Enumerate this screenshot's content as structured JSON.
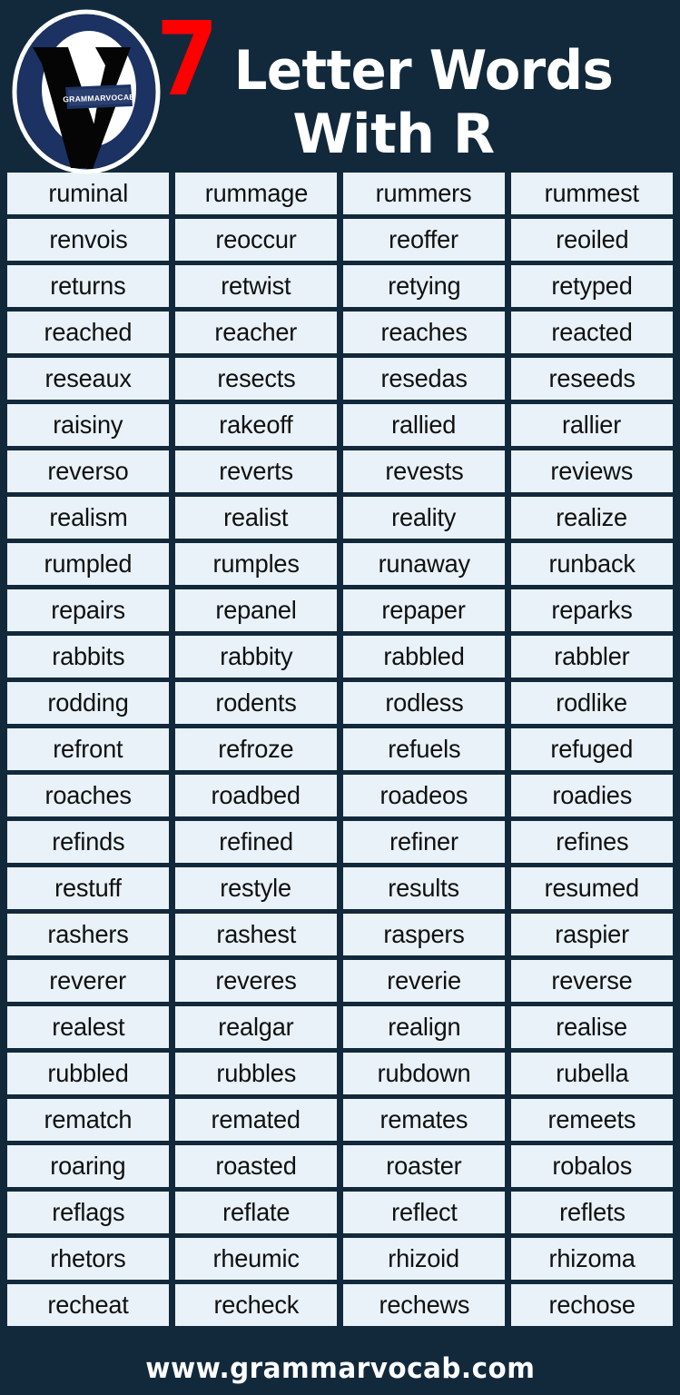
{
  "header": {
    "logo": {
      "name": "grammarvocab-logo",
      "banner_text": "GRAMMARVOCAB",
      "ring_color": "#1b3263",
      "inner_color": "#ffffff",
      "mark_color": "#050505"
    },
    "number": "7",
    "number_color": "#ff0000",
    "title_line1": "Letter Words",
    "title_line2": "With R",
    "title_color": "#ffffff",
    "background_color": "#12293c"
  },
  "grid": {
    "columns": 4,
    "rows": 24,
    "cell_background": "#e9f2f8",
    "cell_text_color": "#101010",
    "words": [
      [
        "ruminal",
        "rummage",
        "rummers",
        "rummest"
      ],
      [
        "renvois",
        "reoccur",
        "reoffer",
        "reoiled"
      ],
      [
        "returns",
        "retwist",
        "retying",
        "retyped"
      ],
      [
        "reached",
        "reacher",
        "reaches",
        "reacted"
      ],
      [
        "reseaux",
        "resects",
        "resedas",
        "reseeds"
      ],
      [
        "raisiny",
        "rakeoff",
        "rallied",
        "rallier"
      ],
      [
        "reverso",
        "reverts",
        "revests",
        "reviews"
      ],
      [
        "realism",
        "realist",
        "reality",
        "realize"
      ],
      [
        "rumpled",
        "rumples",
        "runaway",
        "runback"
      ],
      [
        "repairs",
        "repanel",
        "repaper",
        "reparks"
      ],
      [
        "rabbits",
        "rabbity",
        "rabbled",
        "rabbler"
      ],
      [
        "rodding",
        "rodents",
        "rodless",
        "rodlike"
      ],
      [
        "refront",
        "refroze",
        "refuels",
        "refuged"
      ],
      [
        "roaches",
        "roadbed",
        "roadeos",
        "roadies"
      ],
      [
        "refinds",
        "refined",
        "refiner",
        "refines"
      ],
      [
        "restuff",
        "restyle",
        "results",
        "resumed"
      ],
      [
        "rashers",
        "rashest",
        "raspers",
        "raspier"
      ],
      [
        "reverer",
        "reveres",
        "reverie",
        "reverse"
      ],
      [
        "realest",
        "realgar",
        "realign",
        "realise"
      ],
      [
        "rubbled",
        "rubbles",
        "rubdown",
        "rubella"
      ],
      [
        "rematch",
        "remated",
        "remates",
        "remeets"
      ],
      [
        "roaring",
        "roasted",
        "roaster",
        "robalos"
      ],
      [
        "reflags",
        "reflate",
        "reflect",
        "reflets"
      ],
      [
        "rhetors",
        "rheumic",
        "rhizoid",
        "rhizoma"
      ],
      [
        "recheat",
        "recheck",
        "rechews",
        "rechose"
      ]
    ]
  },
  "footer": {
    "website": "www.grammarvocab.com",
    "text_color": "#ffffff"
  }
}
